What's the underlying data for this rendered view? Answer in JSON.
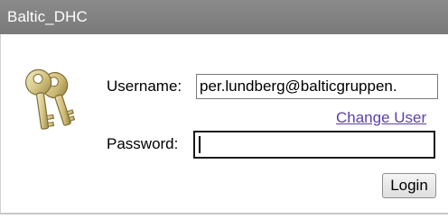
{
  "window": {
    "title": "Baltic_DHC"
  },
  "login": {
    "icon": "keys-icon",
    "username_label": "Username:",
    "username_value": "per.lundberg@balticgruppen.",
    "change_user_label": "Change User",
    "password_label": "Password:",
    "password_value": "",
    "login_button_label": "Login"
  },
  "colors": {
    "titlebar": "#808080",
    "link": "#5b3fae",
    "icon_gold": "#d8c98a"
  }
}
